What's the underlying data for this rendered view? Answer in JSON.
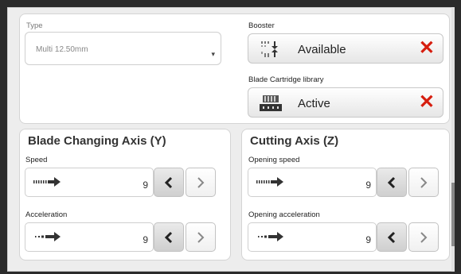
{
  "top": {
    "type": {
      "label": "Type",
      "value": "Multi 12.50mm"
    },
    "booster": {
      "label": "Booster",
      "status": "Available",
      "icon": "booster-icon"
    },
    "blade_library": {
      "label": "Blade Cartridge library",
      "status": "Active",
      "icon": "blade-cartridge-icon"
    }
  },
  "blade_axis": {
    "title": "Blade Changing Axis (Y)",
    "speed": {
      "label": "Speed",
      "value": "9"
    },
    "acceleration": {
      "label": "Acceleration",
      "value": "9"
    }
  },
  "cutting_axis": {
    "title": "Cutting Axis (Z)",
    "speed": {
      "label": "Opening speed",
      "value": "9"
    },
    "acceleration": {
      "label": "Opening acceleration",
      "value": "9"
    }
  },
  "colors": {
    "remove": "#d61e0f",
    "border": "#cfcfcf"
  }
}
